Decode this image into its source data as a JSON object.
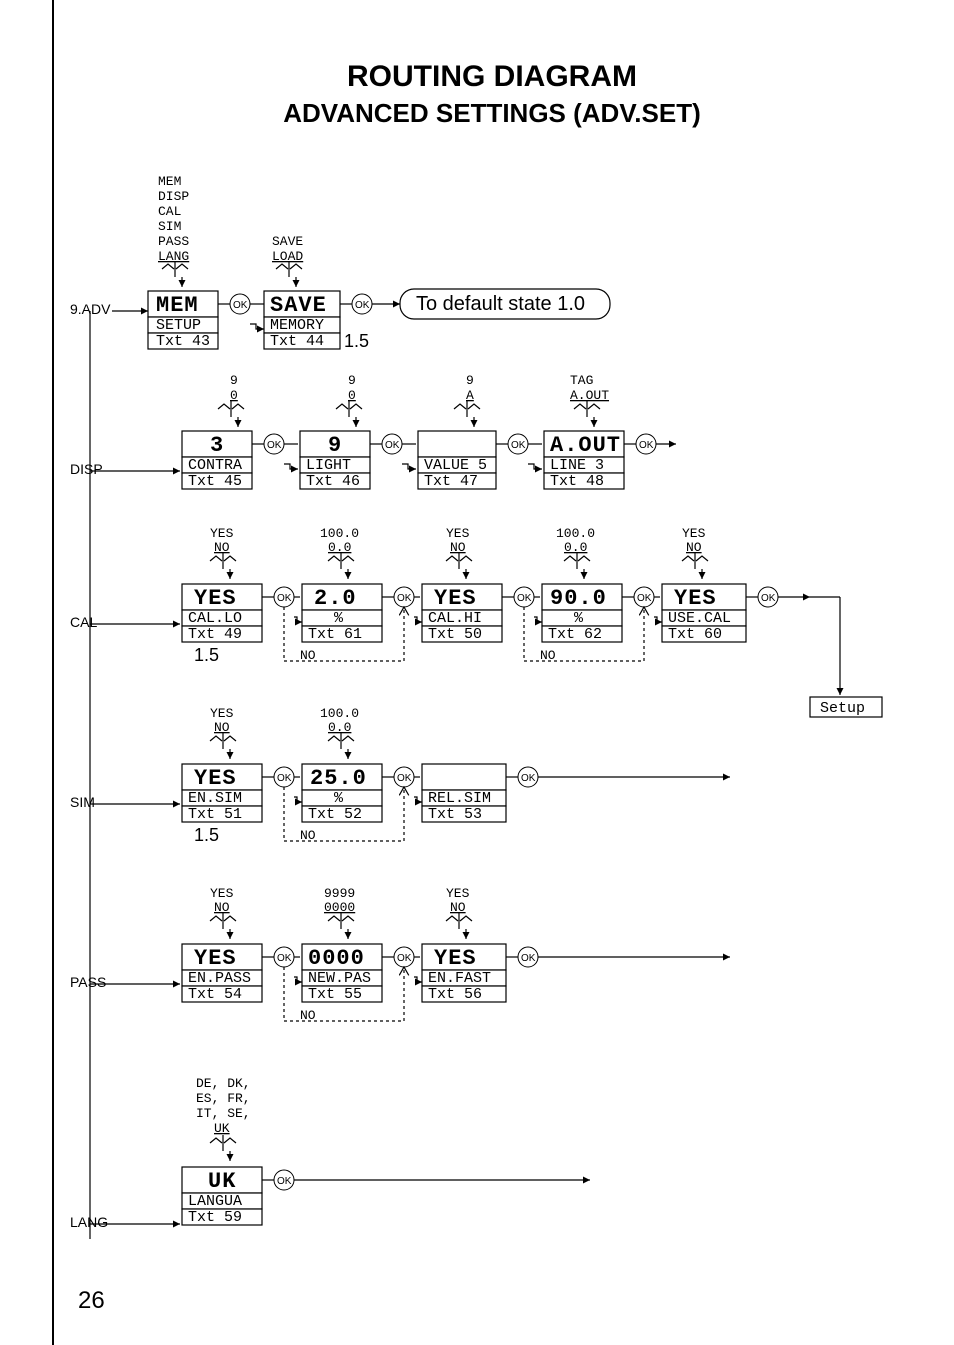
{
  "page_number": "26",
  "title_line1": "ROUTING DIAGRAM",
  "title_line2": "ADVANCED SETTINGS (ADV.SET)",
  "left_branch_label": "9.ADV",
  "row_labels": {
    "disp": "DISP",
    "cal": "CAL",
    "sim": "SIM",
    "pass": "PASS",
    "lang": "LANG"
  },
  "adv_menu_hint": [
    "MEM",
    "DISP",
    "CAL",
    "SIM",
    "PASS",
    "LANG"
  ],
  "save_menu_hint": [
    "SAVE",
    "LOAD"
  ],
  "disp_hint1": [
    "9",
    "0"
  ],
  "disp_hint2": [
    "9",
    "0"
  ],
  "disp_hint3": [
    "9",
    "A"
  ],
  "disp_hint4": [
    "TAG",
    "A.OUT"
  ],
  "cal_yn": [
    "YES",
    "NO"
  ],
  "cal_range": [
    "100.0",
    "0.0"
  ],
  "sim_range": [
    "100.0",
    "0.0"
  ],
  "pass_range": [
    "9999",
    "0000"
  ],
  "lang_options": [
    "DE, DK,",
    "ES, FR,",
    "IT, SE,",
    "UK"
  ],
  "mem_node": {
    "val": "MEM",
    "sub": "SETUP",
    "txt": "Txt 43"
  },
  "save_node": {
    "val": "SAVE",
    "sub": "MEMORY",
    "txt": "Txt 44",
    "note": "1.5"
  },
  "default_state": "To default state 1.0",
  "disp_nodes": [
    {
      "val": "3",
      "sub": "CONTRA",
      "txt": "Txt 45"
    },
    {
      "val": "9",
      "sub": "LIGHT",
      "txt": "Txt 46"
    },
    {
      "val": " ",
      "sub": "VALUE 5",
      "txt": "Txt 47"
    },
    {
      "val": "A.OUT",
      "sub": "LINE 3",
      "txt": "Txt 48"
    }
  ],
  "cal_nodes": [
    {
      "val": "YES",
      "sub": "CAL.LO",
      "txt": "Txt 49",
      "note": "1.5"
    },
    {
      "val": "2.0",
      "sub": "%",
      "txt": "Txt 61",
      "no_branch": true
    },
    {
      "val": "YES",
      "sub": "CAL.HI",
      "txt": "Txt 50"
    },
    {
      "val": "90.0",
      "sub": "%",
      "txt": "Txt 62",
      "no_branch": true
    },
    {
      "val": "YES",
      "sub": "USE.CAL",
      "txt": "Txt 60"
    }
  ],
  "sim_nodes": [
    {
      "val": "YES",
      "sub": "EN.SIM",
      "txt": "Txt 51",
      "note": "1.5"
    },
    {
      "val": "25.0",
      "sub": "%",
      "txt": "Txt 52",
      "no_branch": true
    },
    {
      "val": " ",
      "sub": "REL.SIM",
      "txt": "Txt 53"
    }
  ],
  "pass_nodes": [
    {
      "val": "YES",
      "sub": "EN.PASS",
      "txt": "Txt 54"
    },
    {
      "val": "0000",
      "sub": "NEW.PAS",
      "txt": "Txt 55",
      "no_branch": true
    },
    {
      "val": "YES",
      "sub": "EN.FAST",
      "txt": "Txt 56"
    }
  ],
  "lang_node": {
    "val": "UK",
    "sub": "LANGUA",
    "txt": "Txt 59"
  },
  "no_label": "NO",
  "ok_label": "OK",
  "setup_box": "Setup"
}
